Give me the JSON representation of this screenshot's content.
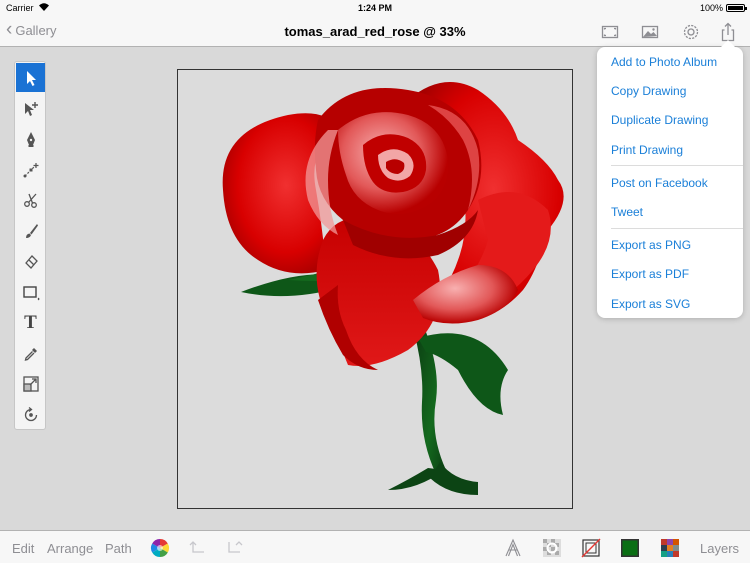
{
  "status_bar": {
    "carrier": "Carrier",
    "time": "1:24 PM",
    "battery": "100%"
  },
  "nav": {
    "back_label": "Gallery",
    "title": "tomas_arad_red_rose @ 33%",
    "icons": [
      "fullscreen-icon",
      "image-icon",
      "gear-icon",
      "share-icon"
    ]
  },
  "tools": [
    {
      "name": "select-arrow-icon",
      "active": true
    },
    {
      "name": "node-select-icon",
      "active": false
    },
    {
      "name": "pen-icon",
      "active": false
    },
    {
      "name": "add-node-icon",
      "active": false
    },
    {
      "name": "scissors-icon",
      "active": false
    },
    {
      "name": "brush-icon",
      "active": false
    },
    {
      "name": "eraser-icon",
      "active": false
    },
    {
      "name": "rectangle-icon",
      "active": false
    },
    {
      "name": "text-icon",
      "active": false
    },
    {
      "name": "eyedropper-icon",
      "active": false
    },
    {
      "name": "scale-icon",
      "active": false
    },
    {
      "name": "rotate-icon",
      "active": false
    }
  ],
  "text_tool_glyph": "T",
  "share_menu": {
    "group1": [
      "Add to Photo Album",
      "Copy Drawing",
      "Duplicate Drawing",
      "Print Drawing"
    ],
    "group2": [
      "Post on Facebook",
      "Tweet"
    ],
    "group3": [
      "Export as PNG",
      "Export as PDF",
      "Export as SVG"
    ]
  },
  "bottom_bar": {
    "edit": "Edit",
    "arrange": "Arrange",
    "path": "Path",
    "layers": "Layers",
    "fill_color": "#0a6e14"
  },
  "colors": {
    "accent": "#1a72d4",
    "link": "#1a7fd8",
    "rose_red": "#d40000",
    "stem_green": "#0b3d12"
  }
}
